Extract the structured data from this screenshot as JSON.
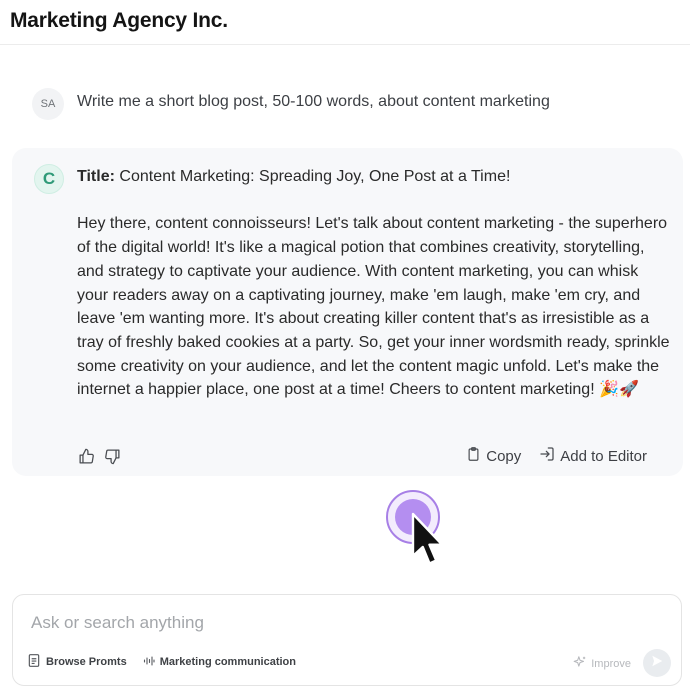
{
  "app": {
    "title": "Marketing Agency Inc."
  },
  "user_message": {
    "avatar_initials": "SA",
    "text": "Write me a short blog post, 50-100 words, about content marketing"
  },
  "reply": {
    "avatar_letter": "C",
    "title_label": "Title:",
    "title_text": "Content Marketing: Spreading Joy, One Post at a Time!",
    "body": "Hey there, content connoisseurs! Let's talk about content marketing - the superhero of the digital world! It's like a magical potion that combines creativity, storytelling, and strategy to captivate your audience. With content marketing, you can whisk your readers away on a captivating journey, make 'em laugh, make 'em cry, and leave 'em wanting more. It's about creating killer content that's as irresistible as a tray of freshly baked cookies at a party. So, get your inner wordsmith ready, sprinkle some creativity on your audience, and let the content magic unfold. Let's make the internet a happier place, one post at a time! Cheers to content marketing! 🎉🚀",
    "copy_label": "Copy",
    "add_to_editor_label": "Add to Editor"
  },
  "composer": {
    "placeholder": "Ask or search anything",
    "browse_prompts_label": "Browse Promts",
    "marketing_label": "Marketing communication",
    "improve_label": "Improve"
  },
  "icons": {
    "thumbs_up": "thumbs-up-icon",
    "thumbs_down": "thumbs-down-icon",
    "copy": "clipboard-icon",
    "add_to_editor": "insert-icon",
    "browse": "document-icon",
    "marketing": "waveform-icon",
    "improve": "sparkle-icon",
    "send": "send-icon"
  },
  "colors": {
    "bot_accent": "#2f9a78",
    "click_indicator": "#b48ef0",
    "card_background": "#f7f8fa"
  }
}
